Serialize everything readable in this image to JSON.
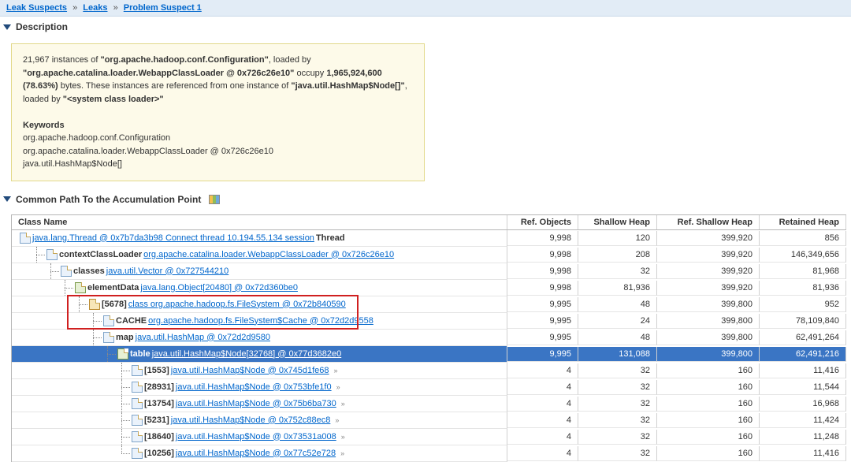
{
  "breadcrumb": [
    {
      "label": "Leak Suspects"
    },
    {
      "label": "Leaks"
    },
    {
      "label": "Problem Suspect 1"
    }
  ],
  "sections": {
    "description_title": "Description",
    "common_path_title": "Common Path To the Accumulation Point"
  },
  "description": {
    "intro_count": "21,967",
    "intro_pre": " instances of ",
    "intro_class": "\"org.apache.hadoop.conf.Configuration\"",
    "intro_mid": ", loaded by ",
    "loaded_by": "\"org.apache.catalina.loader.WebappClassLoader @ 0x726c26e10\"",
    "intro_mid2": " occupy ",
    "bytes": "1,965,924,600 (78.63%)",
    "intro_mid3": " bytes. These instances are referenced from one instance of ",
    "ref_class": "\"java.util.HashMap$Node[]\"",
    "loaded_by2_pre": ", loaded by ",
    "loaded_by2": "\"<system class loader>\"",
    "keywords_title": "Keywords",
    "k1": "org.apache.hadoop.conf.Configuration",
    "k2": "org.apache.catalina.loader.WebappClassLoader @ 0x726c26e10",
    "k3": "java.util.HashMap$Node[]"
  },
  "table": {
    "headers": {
      "c0": "Class Name",
      "c1": "Ref. Objects",
      "c2": "Shallow Heap",
      "c3": "Ref. Shallow Heap",
      "c4": "Retained Heap"
    },
    "rows": [
      {
        "indent": 0,
        "icon": "obj",
        "label_pre": "",
        "link": "java.lang.Thread @ 0x7b7da3b98 Connect thread 10.194.55.134 session",
        "label_post": " Thread",
        "bold_pre": "",
        "ref": "9,998",
        "sh": "120",
        "rsh": "399,920",
        "ret": "856",
        "mini": ""
      },
      {
        "indent": 1,
        "icon": "obj",
        "bold_pre": "contextClassLoader ",
        "link": "org.apache.catalina.loader.WebappClassLoader @ 0x726c26e10",
        "label_post": "",
        "ref": "9,998",
        "sh": "208",
        "rsh": "399,920",
        "ret": "146,349,656",
        "mini": ""
      },
      {
        "indent": 2,
        "icon": "obj",
        "bold_pre": "classes ",
        "link": "java.util.Vector @ 0x727544210",
        "label_post": "",
        "ref": "9,998",
        "sh": "32",
        "rsh": "399,920",
        "ret": "81,968",
        "mini": ""
      },
      {
        "indent": 3,
        "icon": "arr",
        "bold_pre": "elementData ",
        "link": "java.lang.Object[20480] @ 0x72d360be0",
        "label_post": "",
        "ref": "9,998",
        "sh": "81,936",
        "rsh": "399,920",
        "ret": "81,936",
        "mini": ""
      },
      {
        "indent": 4,
        "icon": "class",
        "bold_pre": "[5678] ",
        "link": "class org.apache.hadoop.fs.FileSystem @ 0x72b840590",
        "label_post": "",
        "ref": "9,995",
        "sh": "48",
        "rsh": "399,800",
        "ret": "952",
        "mini": "",
        "hl_start": true
      },
      {
        "indent": 4,
        "icon": "obj",
        "bold_pre": "CACHE ",
        "link": "org.apache.hadoop.fs.FileSystem$Cache @ 0x72d2d9558",
        "label_post": "",
        "ref": "9,995",
        "sh": "24",
        "rsh": "399,800",
        "ret": "78,109,840",
        "mini": "",
        "hl_end": true,
        "extra_indent": 1
      },
      {
        "indent": 5,
        "icon": "obj",
        "bold_pre": "map ",
        "link": "java.util.HashMap @ 0x72d2d9580",
        "label_post": "",
        "ref": "9,995",
        "sh": "48",
        "rsh": "399,800",
        "ret": "62,491,264",
        "mini": ""
      },
      {
        "indent": 6,
        "icon": "arr",
        "bold_pre": "table ",
        "link": "java.util.HashMap$Node[32768] @ 0x77d3682e0",
        "label_post": "",
        "ref": "9,995",
        "sh": "131,088",
        "rsh": "399,800",
        "ret": "62,491,216",
        "mini": "",
        "sel": true
      },
      {
        "indent": 7,
        "icon": "obj",
        "bold_pre": "[1553] ",
        "link": "java.util.HashMap$Node @ 0x745d1fe68",
        "label_post": "",
        "ref": "4",
        "sh": "32",
        "rsh": "160",
        "ret": "11,416",
        "mini": "»"
      },
      {
        "indent": 7,
        "icon": "obj",
        "bold_pre": "[28931] ",
        "link": "java.util.HashMap$Node @ 0x753bfe1f0",
        "label_post": "",
        "ref": "4",
        "sh": "32",
        "rsh": "160",
        "ret": "11,544",
        "mini": "»"
      },
      {
        "indent": 7,
        "icon": "obj",
        "bold_pre": "[13754] ",
        "link": "java.util.HashMap$Node @ 0x75b6ba730",
        "label_post": "",
        "ref": "4",
        "sh": "32",
        "rsh": "160",
        "ret": "16,968",
        "mini": "»"
      },
      {
        "indent": 7,
        "icon": "obj",
        "bold_pre": "[5231] ",
        "link": "java.util.HashMap$Node @ 0x752c88ec8",
        "label_post": "",
        "ref": "4",
        "sh": "32",
        "rsh": "160",
        "ret": "11,424",
        "mini": "»"
      },
      {
        "indent": 7,
        "icon": "obj",
        "bold_pre": "[18640] ",
        "link": "java.util.HashMap$Node @ 0x73531a008",
        "label_post": "",
        "ref": "4",
        "sh": "32",
        "rsh": "160",
        "ret": "11,248",
        "mini": "»"
      },
      {
        "indent": 7,
        "icon": "obj",
        "bold_pre": "[10256] ",
        "link": "java.util.HashMap$Node @ 0x77c52e728",
        "label_post": "",
        "ref": "4",
        "sh": "32",
        "rsh": "160",
        "ret": "11,416",
        "mini": "»"
      }
    ]
  }
}
